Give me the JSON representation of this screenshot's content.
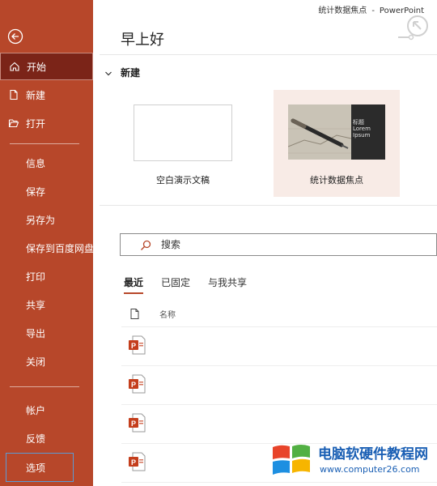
{
  "window": {
    "doc_title": "统计数据焦点",
    "separator": "-",
    "app_name": "PowerPoint"
  },
  "sidebar": {
    "back_icon": "circle-arrow-left-icon",
    "top_items": [
      {
        "label": "开始",
        "icon": "home-icon",
        "active": true
      },
      {
        "label": "新建",
        "icon": "new-document-icon"
      },
      {
        "label": "打开",
        "icon": "folder-open-icon"
      }
    ],
    "middle_items": [
      {
        "label": "信息"
      },
      {
        "label": "保存"
      },
      {
        "label": "另存为"
      },
      {
        "label": "保存到百度网盘"
      },
      {
        "label": "打印"
      },
      {
        "label": "共享"
      },
      {
        "label": "导出"
      },
      {
        "label": "关闭"
      }
    ],
    "bottom_items": [
      {
        "label": "帐户"
      },
      {
        "label": "反馈"
      },
      {
        "label": "选项"
      }
    ]
  },
  "main": {
    "greeting": "早上好",
    "new_section": {
      "title": "新建",
      "templates": [
        {
          "label": "空白演示文稿"
        },
        {
          "label": "统计数据焦点",
          "thumb_text": "标题 Lorem Ipsum"
        }
      ]
    },
    "search": {
      "placeholder": "搜索"
    },
    "tabs": [
      {
        "label": "最近",
        "active": true
      },
      {
        "label": "已固定"
      },
      {
        "label": "与我共享"
      }
    ],
    "list": {
      "column_name": "名称",
      "file_icon": "powerpoint-file-icon"
    }
  },
  "watermark": {
    "title": "电脑软硬件教程网",
    "url": "www.computer26.com"
  },
  "colors": {
    "accent": "#b7472a",
    "active_nav": "#7b2418",
    "template_bg": "#f8ebe6",
    "watermark_blue": "#1a5fb4"
  }
}
